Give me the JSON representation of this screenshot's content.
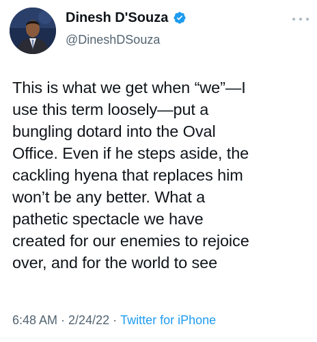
{
  "tweet": {
    "author": {
      "display_name": "Dinesh D'Souza",
      "handle": "@DineshDSouza",
      "verified": true,
      "avatar_icon": "profile-photo"
    },
    "lines": [
      "This is what we get when “we”—I",
      "use this term loosely—put a",
      "bungling dotard into the Oval",
      "Office. Even if he steps aside, the",
      "cackling hyena that replaces him",
      "won’t be any better. What a",
      "pathetic spectacle we have",
      "created for our enemies to rejoice",
      "over, and for the world to see"
    ],
    "time": "6:48 AM",
    "date": "2/24/22",
    "separator": "·",
    "source": "Twitter for iPhone"
  },
  "colors": {
    "accent": "#1d9bf0",
    "text": "#0f1419",
    "secondary": "#536471"
  },
  "icons": {
    "verified": "verified-badge-icon",
    "more": "more-options-icon"
  }
}
